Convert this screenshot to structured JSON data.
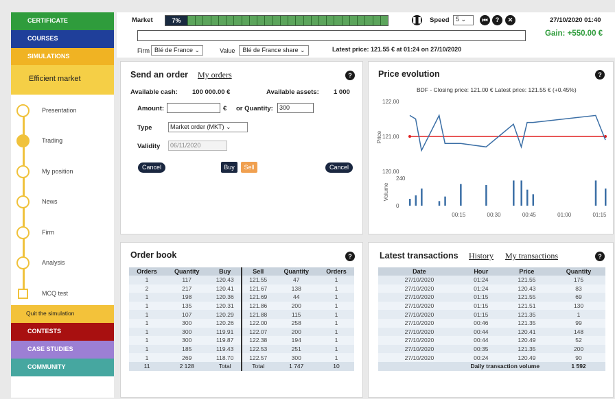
{
  "nav": {
    "certificate": "CERTIFICATE",
    "courses": "COURSES",
    "simulations": "SIMULATIONS",
    "efficient_market": "Efficient market",
    "steps": [
      "Presentation",
      "Trading",
      "My position",
      "News",
      "Firm",
      "Analysis",
      "MCQ test"
    ],
    "quit": "Quit the simulation",
    "contests": "CONTESTS",
    "case_studies": "CASE STUDIES",
    "community": "COMMUNITY"
  },
  "topbar": {
    "market_label": "Market",
    "market_pct": "7%",
    "market_progress": 0.07,
    "speed_label": "Speed",
    "speed_value": "5",
    "datetime": "27/10/2020 01:40",
    "gain": "Gain: +550.00 €",
    "firm_label": "Firm",
    "firm_value": "Blé de France",
    "value_label": "Value",
    "value_value": "Blé de France share",
    "latest_price": "Latest price: 121.55 € at 01:24 on 27/10/2020"
  },
  "order": {
    "title": "Send an order",
    "my_orders": "My orders",
    "cash_label": "Available cash:",
    "cash_value": "100 000.00 €",
    "assets_label": "Available assets:",
    "assets_value": "1 000",
    "amount_label": "Amount:",
    "amount_value": "",
    "currency": "€",
    "quantity_label": "or Quantity:",
    "quantity_value": "300",
    "type_label": "Type",
    "type_value": "Market order (MKT)",
    "validity_label": "Validity",
    "validity_value": "06/11/2020",
    "cancel": "Cancel",
    "buy": "Buy",
    "sell": "Sell"
  },
  "price_panel": {
    "title": "Price evolution"
  },
  "chart_data": {
    "type": "line",
    "title": "BDF - Closing price: 121.00 €   Latest price: 121.55 € (+0.45%)",
    "ylabel": "Price",
    "ylabel2": "Volume",
    "yticks": [
      "122.00",
      "121.00",
      "120.00"
    ],
    "yticks2": [
      "240",
      "0"
    ],
    "xticks": [
      "00:15",
      "00:30",
      "00:45",
      "01:00",
      "01:15"
    ],
    "closing_price": 121.0,
    "ylim": [
      120.0,
      122.0
    ],
    "volume_ylim": [
      0,
      240
    ],
    "price": {
      "x": [
        0.0,
        0.03,
        0.06,
        0.15,
        0.18,
        0.26,
        0.39,
        0.53,
        0.57,
        0.6,
        0.63,
        0.95,
        1.0
      ],
      "y": [
        121.6,
        121.5,
        120.6,
        121.6,
        120.8,
        120.8,
        120.7,
        121.35,
        120.7,
        121.4,
        121.4,
        121.6,
        120.9
      ]
    },
    "volume": {
      "x": [
        0.0,
        0.03,
        0.06,
        0.15,
        0.18,
        0.26,
        0.39,
        0.53,
        0.57,
        0.6,
        0.63,
        0.95,
        1.0
      ],
      "y": [
        60,
        90,
        150,
        40,
        80,
        190,
        180,
        220,
        220,
        140,
        100,
        220,
        150
      ]
    }
  },
  "orderbook": {
    "title": "Order book",
    "headers": [
      "Orders",
      "Quantity",
      "Buy",
      "Sell",
      "Quantity",
      "Orders"
    ],
    "rows": [
      [
        "1",
        "117",
        "120.43",
        "121.55",
        "47",
        "1"
      ],
      [
        "2",
        "217",
        "120.41",
        "121.67",
        "138",
        "1"
      ],
      [
        "1",
        "198",
        "120.36",
        "121.69",
        "44",
        "1"
      ],
      [
        "1",
        "135",
        "120.31",
        "121.86",
        "200",
        "1"
      ],
      [
        "1",
        "107",
        "120.29",
        "121.88",
        "115",
        "1"
      ],
      [
        "1",
        "300",
        "120.26",
        "122.00",
        "258",
        "1"
      ],
      [
        "1",
        "300",
        "119.91",
        "122.07",
        "200",
        "1"
      ],
      [
        "1",
        "300",
        "119.87",
        "122.38",
        "194",
        "1"
      ],
      [
        "1",
        "185",
        "119.43",
        "122.53",
        "251",
        "1"
      ],
      [
        "1",
        "269",
        "118.70",
        "122.57",
        "300",
        "1"
      ]
    ],
    "total": [
      "11",
      "2 128",
      "Total",
      "Total",
      "1 747",
      "10"
    ]
  },
  "transactions": {
    "title": "Latest transactions",
    "history": "History",
    "my_transactions": "My transactions",
    "headers": [
      "Date",
      "Hour",
      "Price",
      "Quantity"
    ],
    "rows": [
      [
        "27/10/2020",
        "01:24",
        "121.55",
        "175"
      ],
      [
        "27/10/2020",
        "01:24",
        "120.43",
        "83"
      ],
      [
        "27/10/2020",
        "01:15",
        "121.55",
        "69"
      ],
      [
        "27/10/2020",
        "01:15",
        "121.51",
        "130"
      ],
      [
        "27/10/2020",
        "01:15",
        "121.35",
        "1"
      ],
      [
        "27/10/2020",
        "00:46",
        "121.35",
        "99"
      ],
      [
        "27/10/2020",
        "00:44",
        "120.41",
        "148"
      ],
      [
        "27/10/2020",
        "00:44",
        "120.49",
        "52"
      ],
      [
        "27/10/2020",
        "00:35",
        "121.35",
        "200"
      ],
      [
        "27/10/2020",
        "00:24",
        "120.49",
        "90"
      ]
    ],
    "volume_label": "Daily transaction volume",
    "volume_value": "1 592"
  },
  "icons": {
    "pause": "pause-icon",
    "rewind": "rewind-icon",
    "help": "help-icon",
    "close": "close-icon"
  }
}
